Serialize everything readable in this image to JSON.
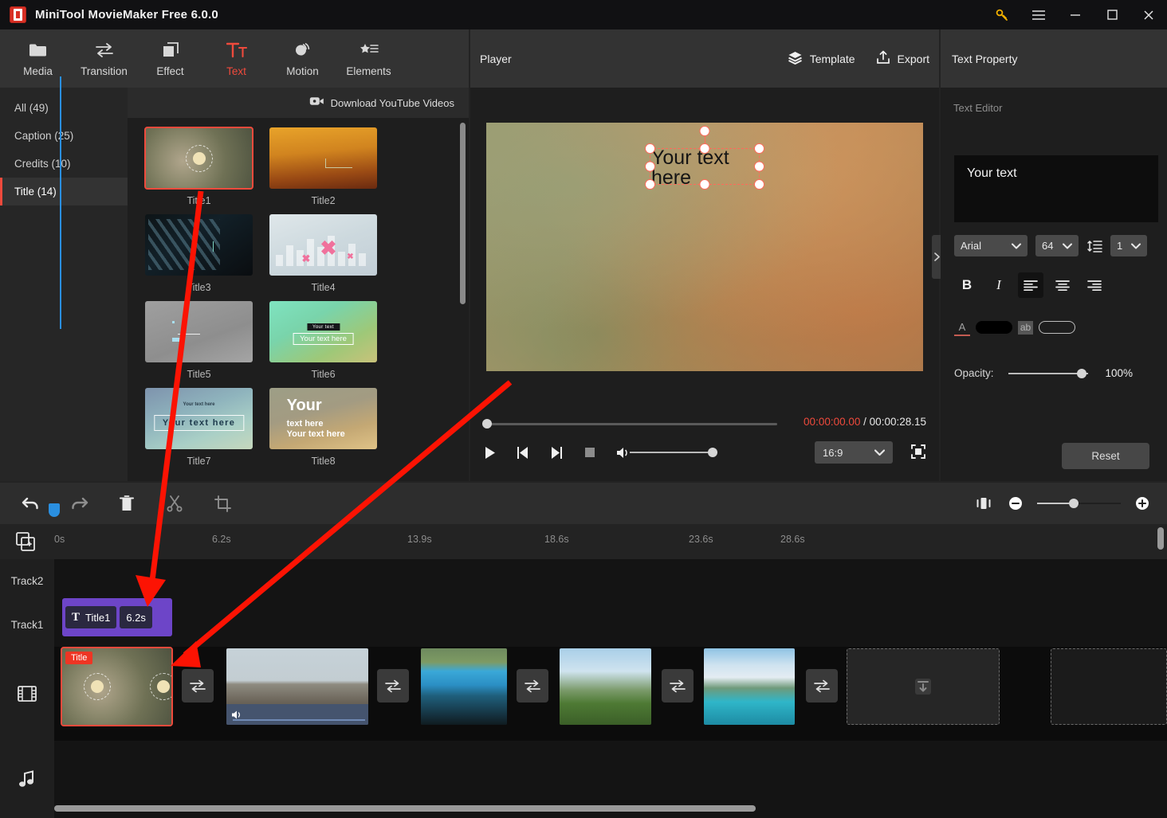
{
  "window": {
    "title": "MiniTool MovieMaker Free 6.0.0",
    "controls": {
      "key": "key-icon",
      "menu": "hamburger-menu-icon",
      "minimize": "minimize-icon",
      "maximize": "maximize-icon",
      "close": "close-icon"
    }
  },
  "toolbar": {
    "items": [
      {
        "label": "Media",
        "icon": "folder-icon",
        "active": false
      },
      {
        "label": "Transition",
        "icon": "transition-arrows-icon",
        "active": false
      },
      {
        "label": "Effect",
        "icon": "layers-square-icon",
        "active": false
      },
      {
        "label": "Text",
        "icon": "text-tt-icon",
        "active": true
      },
      {
        "label": "Motion",
        "icon": "motion-circle-icon",
        "active": false
      },
      {
        "label": "Elements",
        "icon": "star-list-icon",
        "active": false
      }
    ]
  },
  "library": {
    "categories": [
      {
        "label": "All (49)",
        "selected": false
      },
      {
        "label": "Caption (25)",
        "selected": false
      },
      {
        "label": "Credits (10)",
        "selected": false
      },
      {
        "label": "Title (14)",
        "selected": true
      }
    ],
    "download_label": "Download YouTube Videos",
    "templates": [
      {
        "name": "Title1",
        "selected": true
      },
      {
        "name": "Title2",
        "selected": false
      },
      {
        "name": "Title3",
        "selected": false
      },
      {
        "name": "Title4",
        "selected": false
      },
      {
        "name": "Title5",
        "selected": false
      },
      {
        "name": "Title6",
        "selected": false
      },
      {
        "name": "Title7",
        "selected": false
      },
      {
        "name": "Title8",
        "selected": false
      }
    ],
    "thumb_texts": {
      "t6_tag": "Your text",
      "t6_box": "Your text here",
      "t7_small": "Your text here",
      "t7_big": "Your text here",
      "t8_big": "Your",
      "t8_line1": "text here",
      "t8_line2": "Your text here"
    }
  },
  "player": {
    "title": "Player",
    "template_label": "Template",
    "export_label": "Export",
    "overlay_text": "Your text here",
    "current_time": "00:00:00.00",
    "separator": "/",
    "total_time": "00:00:28.15",
    "aspect_ratio": "16:9",
    "transport": [
      "play-icon",
      "previous-frame-icon",
      "next-frame-icon",
      "stop-icon",
      "volume-icon"
    ]
  },
  "properties": {
    "panel_title": "Text Property",
    "section_label": "Text Editor",
    "editor_text": "Your text",
    "font_family": "Arial",
    "font_size": "64",
    "line_spacing": "1",
    "format_buttons": [
      {
        "name": "bold",
        "label": "B",
        "active": false
      },
      {
        "name": "italic",
        "label": "I",
        "active": false
      },
      {
        "name": "align-left",
        "label": "",
        "active": true
      },
      {
        "name": "align-center",
        "label": "",
        "active": false
      },
      {
        "name": "align-right",
        "label": "",
        "active": false
      }
    ],
    "font_color": "#000000",
    "highlight_color": "transparent",
    "opacity_label": "Opacity:",
    "opacity_value": "100%",
    "reset_label": "Reset"
  },
  "timeline": {
    "tools": [
      "undo-icon",
      "redo-icon",
      "delete-icon",
      "split-scissors-icon",
      "crop-icon"
    ],
    "zoom_tools": [
      "fit-to-window-icon",
      "zoom-out-icon",
      "zoom-slider",
      "zoom-in-icon"
    ],
    "ruler_ticks": [
      "0s",
      "6.2s",
      "13.9s",
      "18.6s",
      "23.6s",
      "28.6s"
    ],
    "tracks": [
      {
        "label": "Track2",
        "type": "text"
      },
      {
        "label": "Track1",
        "type": "text"
      },
      {
        "label": "",
        "type": "video",
        "icon": "film-strip-icon"
      },
      {
        "label": "",
        "type": "audio",
        "icon": "music-note-icon"
      }
    ],
    "title_clip": {
      "icon": "T",
      "label": "Title1",
      "duration": "6.2s"
    },
    "video_clips": [
      {
        "name": "title-overlay-clip",
        "badge": "Title",
        "selected": true,
        "has_audio": false
      },
      {
        "name": "balloons-clip",
        "badge": "",
        "selected": false,
        "has_audio": true
      },
      {
        "name": "lagoon-clip",
        "badge": "",
        "selected": false,
        "has_audio": false
      },
      {
        "name": "mountain-clip",
        "badge": "",
        "selected": false,
        "has_audio": false
      },
      {
        "name": "lake-clip",
        "badge": "",
        "selected": false,
        "has_audio": false
      }
    ],
    "transitions": [
      "transition-slot",
      "transition-slot",
      "transition-slot",
      "transition-slot",
      "transition-slot"
    ],
    "placeholders": [
      "import-placeholder",
      "empty-placeholder"
    ]
  },
  "colors": {
    "accent": "#ef4a3c",
    "title_clip": "#6d45c8",
    "playhead": "#2a8fe0",
    "annotation_arrow": "#fc1303",
    "key_icon": "#f3b100"
  }
}
